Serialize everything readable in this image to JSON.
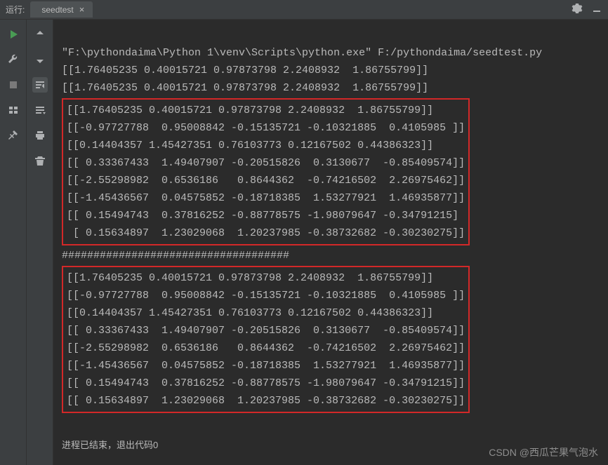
{
  "header": {
    "run_label": "运行:",
    "tab_name": "seedtest"
  },
  "console": {
    "path_line": "\"F:\\pythondaima\\Python 1\\venv\\Scripts\\python.exe\" F:/pythondaima/seedtest.py",
    "line1": "[[1.76405235 0.40015721 0.97873798 2.2408932  1.86755799]]",
    "line2": "[[1.76405235 0.40015721 0.97873798 2.2408932  1.86755799]]",
    "block1": {
      "l1": "[[1.76405235 0.40015721 0.97873798 2.2408932  1.86755799]]",
      "l2": "[[-0.97727788  0.95008842 -0.15135721 -0.10321885  0.4105985 ]]",
      "l3": "[[0.14404357 1.45427351 0.76103773 0.12167502 0.44386323]]",
      "l4": "[[ 0.33367433  1.49407907 -0.20515826  0.3130677  -0.85409574]]",
      "l5": "[[-2.55298982  0.6536186   0.8644362  -0.74216502  2.26975462]]",
      "l6": "[[-1.45436567  0.04575852 -0.18718385  1.53277921  1.46935877]]",
      "l7": "[[ 0.15494743  0.37816252 -0.88778575 -1.98079647 -0.34791215]",
      "l8": " [ 0.15634897  1.23029068  1.20237985 -0.38732682 -0.30230275]]"
    },
    "separator": "####################################",
    "block2": {
      "l1": "[[1.76405235 0.40015721 0.97873798 2.2408932  1.86755799]]",
      "l2": "[[-0.97727788  0.95008842 -0.15135721 -0.10321885  0.4105985 ]]",
      "l3": "[[0.14404357 1.45427351 0.76103773 0.12167502 0.44386323]]",
      "l4": "[[ 0.33367433  1.49407907 -0.20515826  0.3130677  -0.85409574]]",
      "l5": "[[-2.55298982  0.6536186   0.8644362  -0.74216502  2.26975462]]",
      "l6": "[[-1.45436567  0.04575852 -0.18718385  1.53277921  1.46935877]]",
      "l7": "[[ 0.15494743  0.37816252 -0.88778575 -1.98079647 -0.34791215]]",
      "l8": "[[ 0.15634897  1.23029068  1.20237985 -0.38732682 -0.30230275]]"
    },
    "exit_message": "进程已结束，退出代码0"
  },
  "watermark": "CSDN @西瓜芒果气泡水"
}
